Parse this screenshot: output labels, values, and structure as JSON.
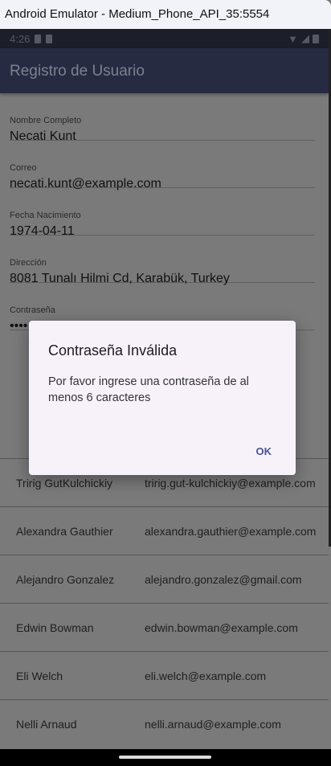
{
  "window": {
    "title": "Android Emulator - Medium_Phone_API_35:5554"
  },
  "status_bar": {
    "time": "4:26"
  },
  "app_bar": {
    "title": "Registro de Usuario"
  },
  "form": {
    "fields": [
      {
        "label": "Nombre Completo",
        "value": "Necati Kunt"
      },
      {
        "label": "Correo",
        "value": "necati.kunt@example.com"
      },
      {
        "label": "Fecha Nacimiento",
        "value": "1974-04-11"
      },
      {
        "label": "Dirección",
        "value": "8081 Tunalı Hilmi Cd, Karabük, Turkey"
      },
      {
        "label": "Contraseña",
        "value": "••••"
      }
    ]
  },
  "users": [
    {
      "name": "Tririg GutKulchickiy",
      "email": "tririg.gut-kulchickiy@example.com"
    },
    {
      "name": "Alexandra Gauthier",
      "email": "alexandra.gauthier@example.com"
    },
    {
      "name": "Alejandro Gonzalez",
      "email": "alejandro.gonzalez@gmail.com"
    },
    {
      "name": "Edwin Bowman",
      "email": "edwin.bowman@example.com"
    },
    {
      "name": "Eli Welch",
      "email": "eli.welch@example.com"
    },
    {
      "name": "Nelli Arnaud",
      "email": "nelli.arnaud@example.com"
    }
  ],
  "dialog": {
    "title": "Contraseña Inválida",
    "message": "Por favor ingrese una contraseña de al menos 6 caracteres",
    "ok_label": "OK"
  }
}
